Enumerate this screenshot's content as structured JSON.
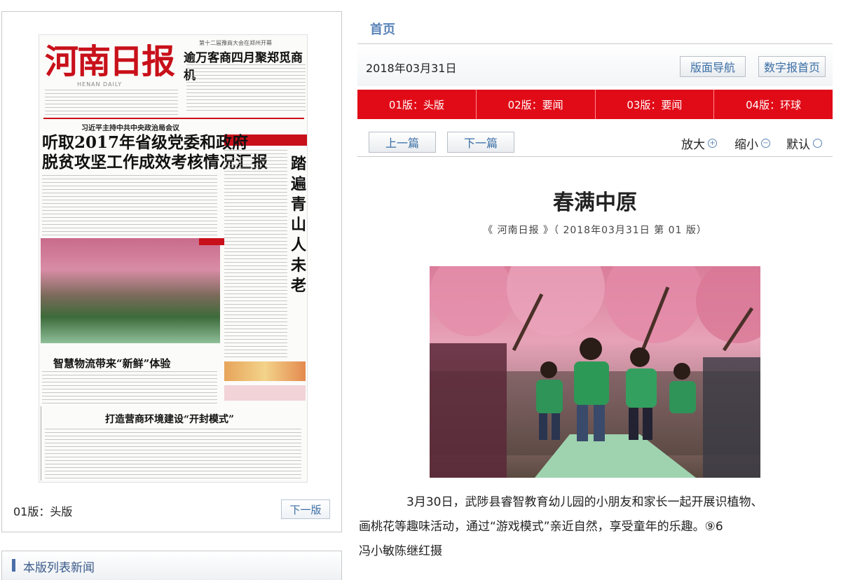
{
  "newspaper": {
    "masthead": "河南日报",
    "english_name": "HENAN DAILY",
    "top_kicker": "第十二届豫商大会在郑州开幕",
    "top_headline": "逾万客商四月聚郑觅商机",
    "lead_kicker": "习近平主持中共中央政治局会议",
    "lead_headline_line1": "听取2017年省级党委和政府",
    "lead_headline_line2": "脱贫攻坚工作成效考核情况汇报",
    "vertical_headline": "踏遍青山人未老",
    "second_headline": "智慧物流带来“新鲜”体验",
    "third_headline": "打造营商环境建设“开封模式”"
  },
  "left_panel": {
    "edition_label": "01版：头版",
    "next_edition_button": "下一版",
    "list_header": "本版列表新闻"
  },
  "header": {
    "home_link": "首页",
    "date": "2018年03月31日",
    "nav_button": "版面导航",
    "digital_home_button": "数字报首页"
  },
  "edition_tabs": [
    {
      "label": "01版：头版"
    },
    {
      "label": "02版：要闻"
    },
    {
      "label": "03版：要闻"
    },
    {
      "label": "04版：环球"
    }
  ],
  "toolbar": {
    "prev_article": "上一篇",
    "next_article": "下一篇",
    "zoom_in": "放大",
    "zoom_out": "缩小",
    "zoom_default": "默认"
  },
  "article": {
    "title": "春满中原",
    "source": "《 河南日报 》（ 2018年03月31日 第 01 版）",
    "caption_line1": "3月30日，武陟县睿智教育幼儿园的小朋友和家长一起开展识植物、",
    "caption_line2": "画桃花等趣味活动，通过“游戏模式”亲近自然，享受童年的乐趣。⑨6",
    "caption_line3": "冯小敏陈继红摄"
  },
  "colors": {
    "brand_red": "#e10b17",
    "link_blue": "#5b84b8",
    "masthead_red": "#c8101a"
  }
}
